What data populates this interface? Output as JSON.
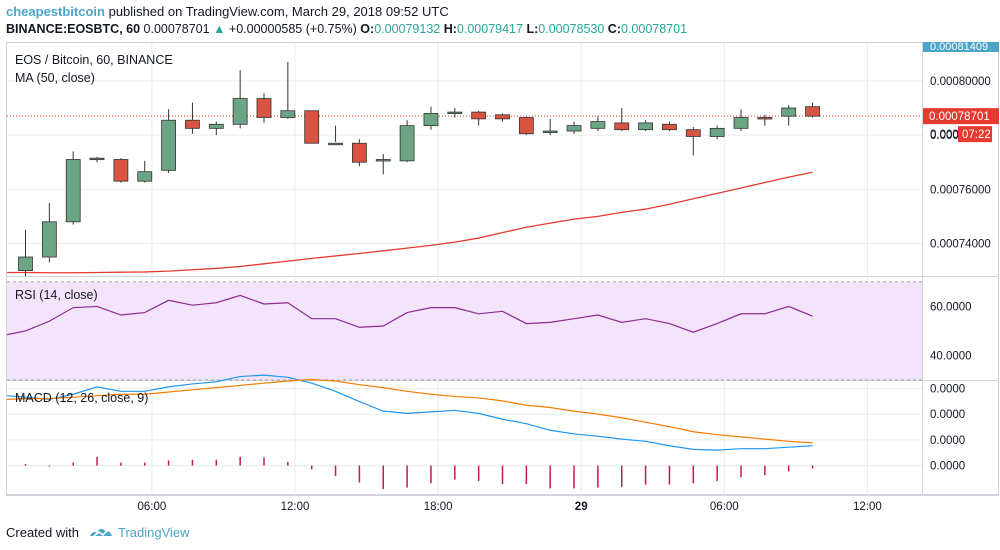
{
  "header": {
    "author": "cheapestbitcoin",
    "published": "published on TradingView.com, March 29, 2018 09:52 UTC",
    "symbol": "BINANCE:EOSBTC, 60",
    "last": "0.00078701",
    "change": "+0.00000585 (+0.75%)",
    "o_label": "O:",
    "o_value": "0.00079132",
    "h_label": "H:",
    "h_value": "0.00079417",
    "l_label": "L:",
    "l_value": "0.00078530",
    "c_label": "C:",
    "c_value": "0.00078701"
  },
  "footer": {
    "created_with": "Created with",
    "brand": "TradingView"
  },
  "colors": {
    "up": "#6ba583",
    "down": "#d75442",
    "ma": "#e63a30",
    "rsi": "#8b2c8e",
    "rsi_band": "#f3e3fb",
    "macd": "#2196f3",
    "signal": "#f57c00",
    "hist": "#c2185b",
    "grid": "#e9ecef",
    "axis_tag": "#e63a30",
    "top_tag": "#4ca5c9"
  },
  "chart_data": [
    {
      "type": "candlestick",
      "title": "EOS / Bitcoin, 60, BINANCE",
      "subtitle": "MA (50, close)",
      "ylim": [
        0.000728,
        0.000814
      ],
      "yticks": [
        "0.00080000",
        "0.00078000",
        "0.00076000",
        "0.00074000"
      ],
      "yticks_values": [
        0.0008,
        0.00078,
        0.00076,
        0.00074
      ],
      "top_label": "0.00081409",
      "price_tag": "0.00078701",
      "countdown_tag": "07:22",
      "countdown_prefix": "0.000",
      "last_price": 0.00078701,
      "x_start": 0,
      "candles": [
        {
          "o": 0.00073,
          "h": 0.000745,
          "l": 0.000728,
          "c": 0.000735
        },
        {
          "o": 0.000735,
          "h": 0.000755,
          "l": 0.000733,
          "c": 0.000748
        },
        {
          "o": 0.000748,
          "h": 0.000774,
          "l": 0.000747,
          "c": 0.000771
        },
        {
          "o": 0.000771,
          "h": 0.000772,
          "l": 0.00077,
          "c": 0.0007715
        },
        {
          "o": 0.000771,
          "h": 0.0007715,
          "l": 0.0007625,
          "c": 0.000763
        },
        {
          "o": 0.000763,
          "h": 0.0007705,
          "l": 0.0007625,
          "c": 0.0007665
        },
        {
          "o": 0.000767,
          "h": 0.0007895,
          "l": 0.000766,
          "c": 0.0007855
        },
        {
          "o": 0.0007855,
          "h": 0.000792,
          "l": 0.0007805,
          "c": 0.0007825
        },
        {
          "o": 0.0007825,
          "h": 0.000785,
          "l": 0.00078,
          "c": 0.000784
        },
        {
          "o": 0.000784,
          "h": 0.000804,
          "l": 0.0007825,
          "c": 0.0007935
        },
        {
          "o": 0.0007935,
          "h": 0.0007955,
          "l": 0.0007845,
          "c": 0.0007865
        },
        {
          "o": 0.0007865,
          "h": 0.000807,
          "l": 0.000786,
          "c": 0.000789
        },
        {
          "o": 0.000789,
          "h": 0.000789,
          "l": 0.000778,
          "c": 0.000777
        },
        {
          "o": 0.000777,
          "h": 0.0007835,
          "l": 0.0007775,
          "c": 0.000777
        },
        {
          "o": 0.000777,
          "h": 0.0007785,
          "l": 0.0007685,
          "c": 0.00077
        },
        {
          "o": 0.0007705,
          "h": 0.000773,
          "l": 0.0007655,
          "c": 0.000771
        },
        {
          "o": 0.0007705,
          "h": 0.0007855,
          "l": 0.00077,
          "c": 0.0007835
        },
        {
          "o": 0.0007835,
          "h": 0.0007905,
          "l": 0.000782,
          "c": 0.000788
        },
        {
          "o": 0.000788,
          "h": 0.00079,
          "l": 0.0007865,
          "c": 0.0007885
        },
        {
          "o": 0.0007885,
          "h": 0.000789,
          "l": 0.0007835,
          "c": 0.000786
        },
        {
          "o": 0.0007875,
          "h": 0.000788,
          "l": 0.000785,
          "c": 0.000786
        },
        {
          "o": 0.0007865,
          "h": 0.000787,
          "l": 0.00078,
          "c": 0.0007805
        },
        {
          "o": 0.000781,
          "h": 0.000786,
          "l": 0.00078,
          "c": 0.0007815
        },
        {
          "o": 0.0007815,
          "h": 0.000785,
          "l": 0.0007805,
          "c": 0.0007835
        },
        {
          "o": 0.0007825,
          "h": 0.000787,
          "l": 0.0007815,
          "c": 0.000785
        },
        {
          "o": 0.0007845,
          "h": 0.00079,
          "l": 0.0007815,
          "c": 0.000782
        },
        {
          "o": 0.000782,
          "h": 0.0007855,
          "l": 0.0007815,
          "c": 0.0007845
        },
        {
          "o": 0.000784,
          "h": 0.000785,
          "l": 0.0007815,
          "c": 0.000782
        },
        {
          "o": 0.000782,
          "h": 0.000783,
          "l": 0.0007725,
          "c": 0.0007795
        },
        {
          "o": 0.0007795,
          "h": 0.0007835,
          "l": 0.0007785,
          "c": 0.0007825
        },
        {
          "o": 0.0007825,
          "h": 0.0007895,
          "l": 0.0007815,
          "c": 0.0007865
        },
        {
          "o": 0.0007865,
          "h": 0.0007875,
          "l": 0.0007835,
          "c": 0.000786
        },
        {
          "o": 0.000787,
          "h": 0.000791,
          "l": 0.0007835,
          "c": 0.00079
        },
        {
          "o": 0.0007905,
          "h": 0.000792,
          "l": 0.0007865,
          "c": 0.000787
        }
      ],
      "ma": [
        0.0007293,
        0.0007292,
        0.0007292,
        0.0007293,
        0.0007294,
        0.0007295,
        0.0007298,
        0.0007303,
        0.0007308,
        0.0007315,
        0.0007325,
        0.0007335,
        0.0007345,
        0.0007354,
        0.0007363,
        0.0007373,
        0.0007383,
        0.0007393,
        0.0007405,
        0.000742,
        0.000744,
        0.000746,
        0.0007475,
        0.000749,
        0.00075,
        0.0007515,
        0.0007527,
        0.0007545,
        0.0007565,
        0.0007585,
        0.0007605,
        0.0007625,
        0.0007645,
        0.0007663
      ],
      "x_ticks": [
        "06:00",
        "12:00",
        "18:00",
        "29",
        "06:00",
        "12:00"
      ]
    },
    {
      "type": "line",
      "title": "RSI (14, close)",
      "ylim": [
        30,
        72
      ],
      "band": [
        30,
        70
      ],
      "yticks": [
        "60.0000",
        "40.0000"
      ],
      "yticks_values": [
        60,
        40
      ],
      "values": [
        50,
        54,
        59.5,
        60,
        56.5,
        57.5,
        62.5,
        60.5,
        61.5,
        64.5,
        61,
        61.5,
        55,
        55,
        51.5,
        52,
        57.5,
        59.5,
        59.5,
        57,
        58,
        53,
        53.5,
        55,
        56.5,
        53.5,
        55,
        53,
        49.5,
        53,
        57,
        57,
        60,
        56
      ]
    },
    {
      "type": "line",
      "title": "MACD (12, 26, close, 9)",
      "ylim": [
        -7.5e-06,
        8e-06
      ],
      "yticks": [
        "0.0000",
        "0.0000",
        "0.0000",
        "0.0000"
      ],
      "yticks_values": [
        7e-06,
        3.5e-06,
        0,
        -3.5e-06
      ],
      "series": [
        {
          "values": [
            5.8e-06,
            5.5e-06,
            6.2e-06,
            7.2e-06,
            6.6e-06,
            6.6e-06,
            7.2e-06,
            7.6e-06,
            7.9e-06,
            8.6e-06,
            8.8e-06,
            8.5e-06,
            7.7e-06,
            6.6e-06,
            5.2e-06,
            3.9e-06,
            3.6e-06,
            3.8e-06,
            4e-06,
            3.6e-06,
            2.8e-06,
            2.2e-06,
            1.3e-06,
            8e-07,
            5e-07,
            1e-07,
            -2e-07,
            -8e-07,
            -1.3e-06,
            -1.4e-06,
            -1.2e-06,
            -1.2e-06,
            -1e-06,
            -8e-07
          ]
        },
        {
          "values": [
            5.6e-06,
            5.6e-06,
            5.8e-06,
            6e-06,
            6.2e-06,
            6.2e-06,
            6.5e-06,
            6.8e-06,
            7.1e-06,
            7.4e-06,
            7.7e-06,
            8e-06,
            8.2e-06,
            8e-06,
            7.5e-06,
            7.1e-06,
            6.6e-06,
            6.2e-06,
            5.9e-06,
            5.7e-06,
            5.3e-06,
            4.7e-06,
            4.4e-06,
            3.9e-06,
            3.5e-06,
            3e-06,
            2.4e-06,
            1.8e-06,
            1.1e-06,
            7e-07,
            4e-07,
            1e-07,
            -2e-07,
            -4e-07
          ]
        }
      ],
      "histogram": [
        2e-07,
        -1e-07,
        4e-07,
        1.2e-06,
        4e-07,
        4e-07,
        7e-07,
        8e-07,
        8e-07,
        1.2e-06,
        1.1e-06,
        5e-07,
        -5e-07,
        -1.4e-06,
        -2.3e-06,
        -3.2e-06,
        -3e-06,
        -2.4e-06,
        -1.9e-06,
        -2.1e-06,
        -2.5e-06,
        -2.5e-06,
        -3.1e-06,
        -3.1e-06,
        -3e-06,
        -2.9e-06,
        -2.6e-06,
        -2.6e-06,
        -2.4e-06,
        -2.1e-06,
        -1.6e-06,
        -1.3e-06,
        -8e-07,
        -4e-07
      ]
    }
  ]
}
